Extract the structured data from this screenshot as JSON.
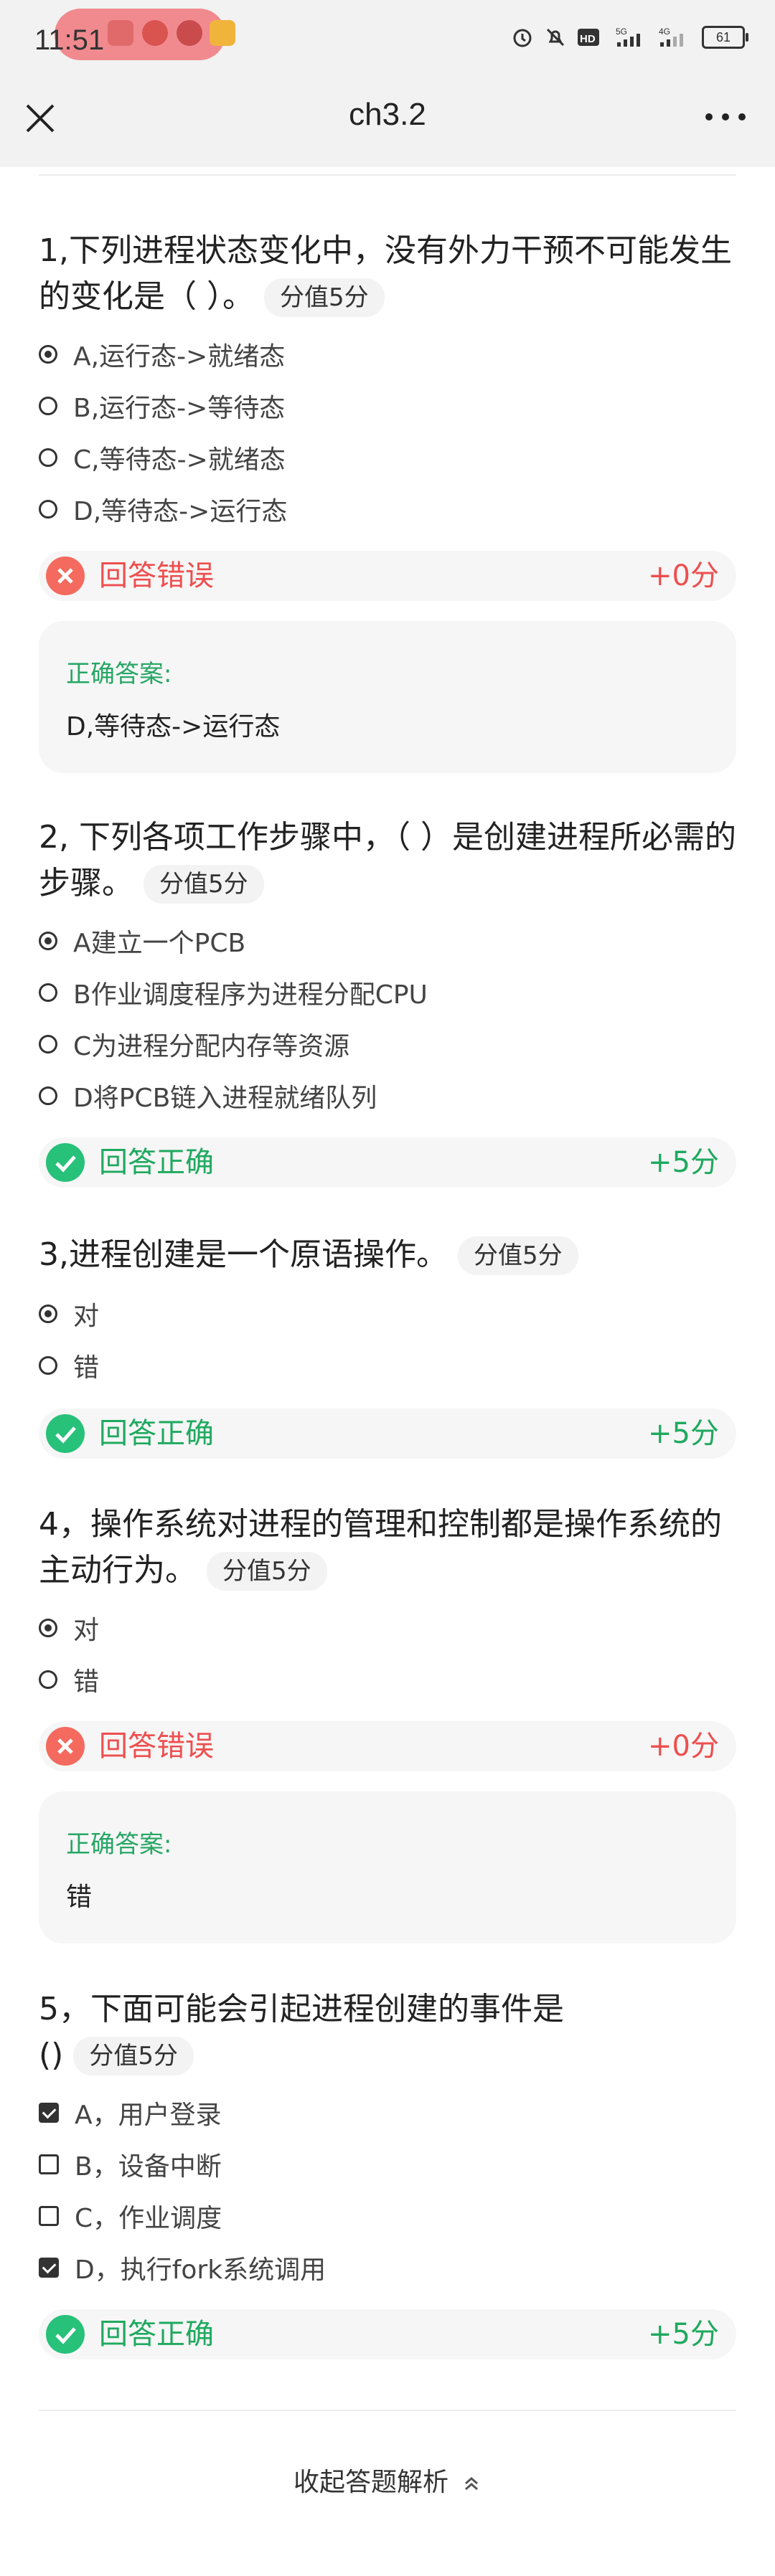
{
  "status_bar": {
    "time": "11:51",
    "battery": "61"
  },
  "nav": {
    "title": "ch3.2"
  },
  "questions": [
    {
      "title": "1,下列进程状态变化中，没有外力干预不可能发生的变化是（ ）。",
      "score_tag": "分值5分",
      "options": [
        "A,运行态->就绪态",
        "B,运行态->等待态",
        "C,等待态->就绪态",
        "D,等待态->运行态"
      ],
      "result_text": "回答错误",
      "result_score": "+0分",
      "answer_label": "正确答案:",
      "answer_value": "D,等待态->运行态"
    },
    {
      "title": "2, 下列各项工作步骤中，（ ）是创建进程所必需的步骤。",
      "score_tag": "分值5分",
      "options": [
        "A建立一个PCB",
        "B作业调度程序为进程分配CPU",
        "C为进程分配内存等资源",
        "D将PCB链入进程就绪队列"
      ],
      "result_text": "回答正确",
      "result_score": "+5分"
    },
    {
      "title": "3,进程创建是一个原语操作。",
      "score_tag": "分值5分",
      "options": [
        "对",
        "错"
      ],
      "result_text": "回答正确",
      "result_score": "+5分"
    },
    {
      "title": "4，操作系统对进程的管理和控制都是操作系统的主动行为。",
      "score_tag": "分值5分",
      "options": [
        "对",
        "错"
      ],
      "result_text": "回答错误",
      "result_score": "+0分",
      "answer_label": "正确答案:",
      "answer_value": "错"
    },
    {
      "title_line1": "5，下面可能会引起进程创建的事件是",
      "title_line2": "()",
      "score_tag": "分值5分",
      "options": [
        "A，用户登录",
        "B，设备中断",
        "C，作业调度",
        "D，执行fork系统调用"
      ],
      "result_text": "回答正确",
      "result_score": "+5分"
    }
  ],
  "footer": {
    "collapse_label": "收起答题解析"
  },
  "colors": {
    "wrong": "#ee4f4f",
    "right": "#1fa95f",
    "answer_label": "#27a665"
  }
}
